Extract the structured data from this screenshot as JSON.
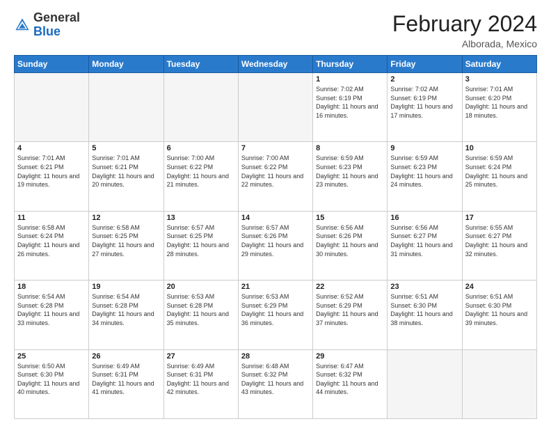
{
  "header": {
    "logo": {
      "line1": "General",
      "line2": "Blue"
    },
    "title": "February 2024",
    "subtitle": "Alborada, Mexico"
  },
  "days_of_week": [
    "Sunday",
    "Monday",
    "Tuesday",
    "Wednesday",
    "Thursday",
    "Friday",
    "Saturday"
  ],
  "weeks": [
    [
      {
        "day": "",
        "info": ""
      },
      {
        "day": "",
        "info": ""
      },
      {
        "day": "",
        "info": ""
      },
      {
        "day": "",
        "info": ""
      },
      {
        "day": "1",
        "info": "Sunrise: 7:02 AM\nSunset: 6:19 PM\nDaylight: 11 hours and 16 minutes."
      },
      {
        "day": "2",
        "info": "Sunrise: 7:02 AM\nSunset: 6:19 PM\nDaylight: 11 hours and 17 minutes."
      },
      {
        "day": "3",
        "info": "Sunrise: 7:01 AM\nSunset: 6:20 PM\nDaylight: 11 hours and 18 minutes."
      }
    ],
    [
      {
        "day": "4",
        "info": "Sunrise: 7:01 AM\nSunset: 6:21 PM\nDaylight: 11 hours and 19 minutes."
      },
      {
        "day": "5",
        "info": "Sunrise: 7:01 AM\nSunset: 6:21 PM\nDaylight: 11 hours and 20 minutes."
      },
      {
        "day": "6",
        "info": "Sunrise: 7:00 AM\nSunset: 6:22 PM\nDaylight: 11 hours and 21 minutes."
      },
      {
        "day": "7",
        "info": "Sunrise: 7:00 AM\nSunset: 6:22 PM\nDaylight: 11 hours and 22 minutes."
      },
      {
        "day": "8",
        "info": "Sunrise: 6:59 AM\nSunset: 6:23 PM\nDaylight: 11 hours and 23 minutes."
      },
      {
        "day": "9",
        "info": "Sunrise: 6:59 AM\nSunset: 6:23 PM\nDaylight: 11 hours and 24 minutes."
      },
      {
        "day": "10",
        "info": "Sunrise: 6:59 AM\nSunset: 6:24 PM\nDaylight: 11 hours and 25 minutes."
      }
    ],
    [
      {
        "day": "11",
        "info": "Sunrise: 6:58 AM\nSunset: 6:24 PM\nDaylight: 11 hours and 26 minutes."
      },
      {
        "day": "12",
        "info": "Sunrise: 6:58 AM\nSunset: 6:25 PM\nDaylight: 11 hours and 27 minutes."
      },
      {
        "day": "13",
        "info": "Sunrise: 6:57 AM\nSunset: 6:25 PM\nDaylight: 11 hours and 28 minutes."
      },
      {
        "day": "14",
        "info": "Sunrise: 6:57 AM\nSunset: 6:26 PM\nDaylight: 11 hours and 29 minutes."
      },
      {
        "day": "15",
        "info": "Sunrise: 6:56 AM\nSunset: 6:26 PM\nDaylight: 11 hours and 30 minutes."
      },
      {
        "day": "16",
        "info": "Sunrise: 6:56 AM\nSunset: 6:27 PM\nDaylight: 11 hours and 31 minutes."
      },
      {
        "day": "17",
        "info": "Sunrise: 6:55 AM\nSunset: 6:27 PM\nDaylight: 11 hours and 32 minutes."
      }
    ],
    [
      {
        "day": "18",
        "info": "Sunrise: 6:54 AM\nSunset: 6:28 PM\nDaylight: 11 hours and 33 minutes."
      },
      {
        "day": "19",
        "info": "Sunrise: 6:54 AM\nSunset: 6:28 PM\nDaylight: 11 hours and 34 minutes."
      },
      {
        "day": "20",
        "info": "Sunrise: 6:53 AM\nSunset: 6:28 PM\nDaylight: 11 hours and 35 minutes."
      },
      {
        "day": "21",
        "info": "Sunrise: 6:53 AM\nSunset: 6:29 PM\nDaylight: 11 hours and 36 minutes."
      },
      {
        "day": "22",
        "info": "Sunrise: 6:52 AM\nSunset: 6:29 PM\nDaylight: 11 hours and 37 minutes."
      },
      {
        "day": "23",
        "info": "Sunrise: 6:51 AM\nSunset: 6:30 PM\nDaylight: 11 hours and 38 minutes."
      },
      {
        "day": "24",
        "info": "Sunrise: 6:51 AM\nSunset: 6:30 PM\nDaylight: 11 hours and 39 minutes."
      }
    ],
    [
      {
        "day": "25",
        "info": "Sunrise: 6:50 AM\nSunset: 6:30 PM\nDaylight: 11 hours and 40 minutes."
      },
      {
        "day": "26",
        "info": "Sunrise: 6:49 AM\nSunset: 6:31 PM\nDaylight: 11 hours and 41 minutes."
      },
      {
        "day": "27",
        "info": "Sunrise: 6:49 AM\nSunset: 6:31 PM\nDaylight: 11 hours and 42 minutes."
      },
      {
        "day": "28",
        "info": "Sunrise: 6:48 AM\nSunset: 6:32 PM\nDaylight: 11 hours and 43 minutes."
      },
      {
        "day": "29",
        "info": "Sunrise: 6:47 AM\nSunset: 6:32 PM\nDaylight: 11 hours and 44 minutes."
      },
      {
        "day": "",
        "info": ""
      },
      {
        "day": "",
        "info": ""
      }
    ]
  ]
}
